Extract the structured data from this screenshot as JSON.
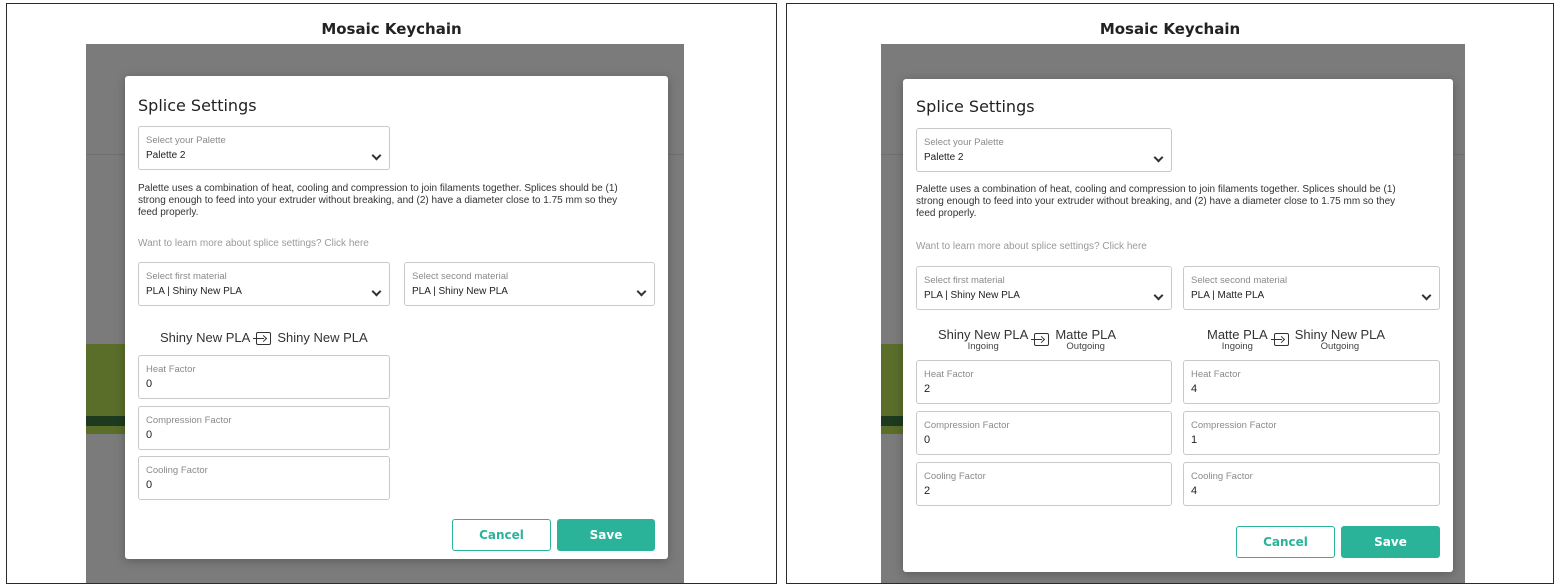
{
  "left": {
    "app_title": "Mosaic Keychain",
    "modal_title": "Splice Settings",
    "palette": {
      "label": "Select your Palette",
      "value": "Palette 2"
    },
    "description": [
      "Palette uses a combination of heat, cooling and compression to join filaments together. Splices should be (1)",
      "strong enough to feed into your extruder without breaking, and (2) have a diameter close to 1.75 mm so they",
      "feed properly."
    ],
    "learn_more": "Want to learn more about splice settings? Click here",
    "first_material": {
      "label": "Select first material",
      "value": "PLA | Shiny New PLA"
    },
    "second_material": {
      "label": "Select second material",
      "value": "PLA | Shiny New PLA"
    },
    "transition": {
      "from": "Shiny New PLA",
      "to": "Shiny New PLA"
    },
    "factors": [
      {
        "label": "Heat Factor",
        "value": "0"
      },
      {
        "label": "Compression Factor",
        "value": "0"
      },
      {
        "label": "Cooling Factor",
        "value": "0"
      }
    ],
    "cancel_label": "Cancel",
    "save_label": "Save"
  },
  "right": {
    "app_title": "Mosaic Keychain",
    "modal_title": "Splice Settings",
    "palette": {
      "label": "Select your Palette",
      "value": "Palette 2"
    },
    "description": [
      "Palette uses a combination of heat, cooling and compression to join filaments together. Splices should be (1)",
      "strong enough to feed into your extruder without breaking, and (2) have a diameter close to 1.75 mm so they",
      "feed properly."
    ],
    "learn_more": "Want to learn more about splice settings? Click here",
    "first_material": {
      "label": "Select first material",
      "value": "PLA | Shiny New PLA"
    },
    "second_material": {
      "label": "Select second material",
      "value": "PLA | Matte PLA"
    },
    "transition_a": {
      "from": "Shiny New PLA",
      "from_sub": "Ingoing",
      "to": "Matte PLA",
      "to_sub": "Outgoing"
    },
    "transition_b": {
      "from": "Matte PLA",
      "from_sub": "Ingoing",
      "to": "Shiny New PLA",
      "to_sub": "Outgoing"
    },
    "factors_a": [
      {
        "label": "Heat Factor",
        "value": "2"
      },
      {
        "label": "Compression Factor",
        "value": "0"
      },
      {
        "label": "Cooling Factor",
        "value": "2"
      }
    ],
    "factors_b": [
      {
        "label": "Heat Factor",
        "value": "4"
      },
      {
        "label": "Compression Factor",
        "value": "1"
      },
      {
        "label": "Cooling Factor",
        "value": "4"
      }
    ],
    "cancel_label": "Cancel",
    "save_label": "Save"
  },
  "colors": {
    "accent": "#2bb39a",
    "backdrop": "#7b7b7b"
  },
  "icons": {
    "select_arrow": "chevron-down-icon",
    "transition": "swap-arrow-icon"
  }
}
